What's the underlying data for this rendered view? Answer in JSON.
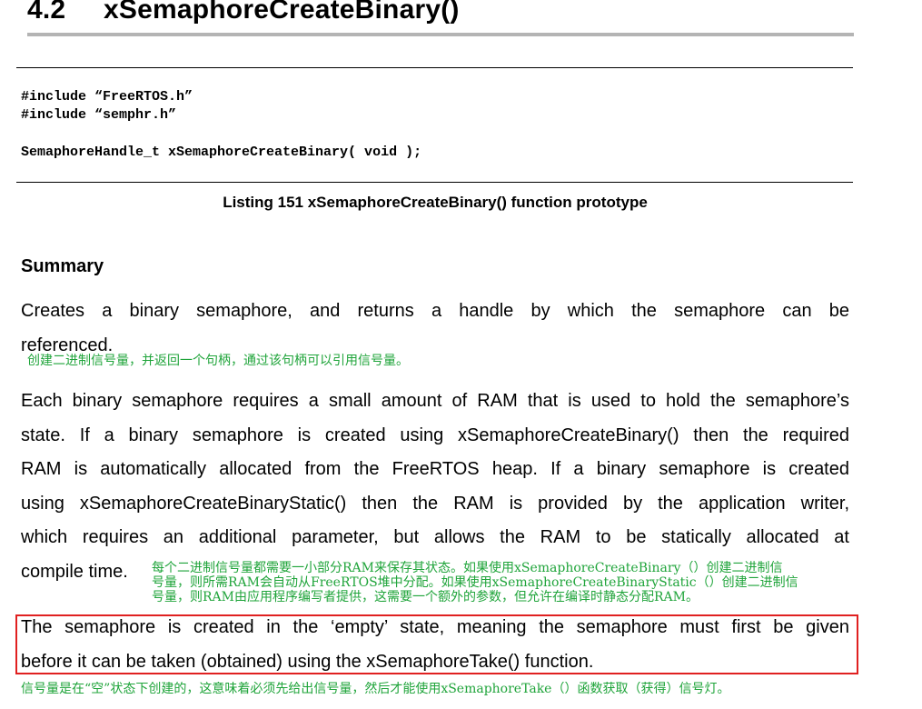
{
  "section": {
    "number": "4.2",
    "title": "xSemaphoreCreateBinary()"
  },
  "code": {
    "include1": "#include “FreeRTOS.h”",
    "include2": "#include “semphr.h”",
    "prototype": "SemaphoreHandle_t xSemaphoreCreateBinary( void );"
  },
  "listing_caption": "Listing 151 xSemaphoreCreateBinary() function prototype",
  "summary": {
    "heading": "Summary",
    "para1": {
      "lines": [
        "Creates a binary semaphore, and returns a handle by which the semaphore can be",
        "referenced."
      ],
      "annotation": "创建二进制信号量，并返回一个句柄，通过该句柄可以引用信号量。"
    },
    "para2": {
      "lines": [
        "Each binary semaphore requires a small amount of RAM that is used to hold the semaphore’s",
        "state.  If a binary semaphore is created using xSemaphoreCreateBinary() then the required",
        "RAM is automatically allocated from the FreeRTOS heap.  If a binary semaphore is created",
        "using xSemaphoreCreateBinaryStatic() then the RAM is provided by the application writer,",
        "which requires an additional parameter, but allows the RAM to be statically allocated at",
        "compile time."
      ],
      "annotation": [
        "每个二进制信号量都需要一小部分RAM来保存其状态。如果使用xSemaphoreCreateBinary（）创建二进制信",
        "号量，则所需RAM会自动从FreeRTOS堆中分配。如果使用xSemaphoreCreateBinaryStatic（）创建二进制信",
        "号量，则RAM由应用程序编写者提供，这需要一个额外的参数，但允许在编译时静态分配RAM。"
      ]
    },
    "para3": {
      "lines": [
        "The semaphore is created in the ‘empty’ state, meaning the semaphore must first be given",
        "before it can be taken (obtained) using the xSemaphoreTake() function."
      ],
      "annotation": "信号量是在“空”状态下创建的，这意味着必须先给出信号量，然后才能使用xSemaphoreTake（）函数获取（获得）信号灯。"
    }
  },
  "colors": {
    "annotation_green": "#1fa43a",
    "highlight_box_red": "#e02020",
    "heading_rule_gray": "#b4b4b4"
  }
}
